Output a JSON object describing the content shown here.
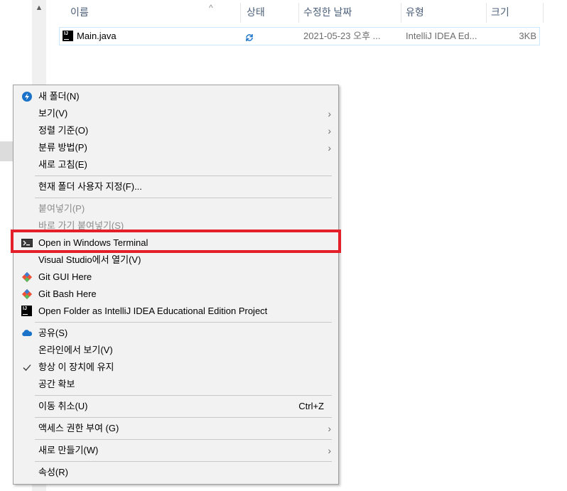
{
  "columns": [
    {
      "label": "이름"
    },
    {
      "label": "상태"
    },
    {
      "label": "수정한 날짜"
    },
    {
      "label": "유형"
    },
    {
      "label": "크기"
    }
  ],
  "file": {
    "name": "Main.java",
    "modified": "2021-05-23 오후 ...",
    "type": "IntelliJ IDEA Ed...",
    "size": "3KB"
  },
  "menu": {
    "new_folder": "새 폴더(N)",
    "view": "보기(V)",
    "sort_by": "정렬 기준(O)",
    "group_by": "분류 방법(P)",
    "refresh": "새로 고침(E)",
    "customize": "현재 폴더 사용자 지정(F)...",
    "paste": "붙여넣기(P)",
    "paste_shortcut": "바로 가기 붙여넣기(S)",
    "open_terminal": "Open in Windows Terminal",
    "open_vs": "Visual Studio에서 열기(V)",
    "git_gui": "Git GUI Here",
    "git_bash": "Git Bash Here",
    "open_intellij": "Open Folder as IntelliJ IDEA Educational Edition Project",
    "share": "공유(S)",
    "view_online": "온라인에서 보기(V)",
    "always_keep": "항상 이 장치에 유지",
    "free_space": "공간 확보",
    "undo_move": "이동 취소(U)",
    "undo_shortcut": "Ctrl+Z",
    "give_access": "액세스 권한 부여 (G)",
    "new": "새로 만들기(W)",
    "properties": "속성(R)"
  },
  "icons": {
    "sort": "chevron-up-icon",
    "sync": "sync-icon",
    "intellij": "intellij-icon",
    "terminal": "terminal-icon",
    "git": "git-icon",
    "onedrive": "onedrive-cloud-icon",
    "check": "checkmark-icon",
    "submenu": "chevron-right-icon"
  },
  "colors": {
    "highlight_border": "#e3202a",
    "menu_bg": "#f2f2f2",
    "header_text": "#4c607a",
    "selection_border": "#cce8ff",
    "onedrive": "#1a73c9",
    "git": "#f05033"
  }
}
